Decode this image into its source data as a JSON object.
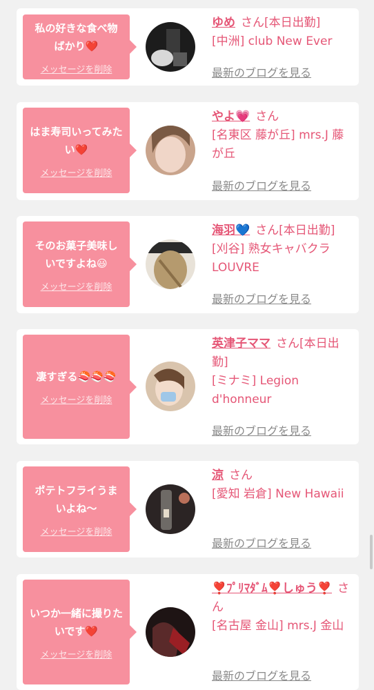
{
  "ui": {
    "delete_label": "メッセージを削除",
    "blog_label": "最新のブログを見る",
    "suffix": "さん"
  },
  "colors": {
    "bubble": "#f7909e",
    "accent": "#e55676",
    "link_gray": "#8a8a8a",
    "background": "#f1f1f1"
  },
  "messages": [
    {
      "text": "私の好きな食べ物ばかり❤️",
      "name": "ゆめ",
      "suffix": "さん[本日出勤]",
      "location": "[中洲] club New Ever"
    },
    {
      "text": "はま寿司いってみたい❤️",
      "name": "やよ💗",
      "suffix": "さん",
      "location": "[名東区 藤が丘] mrs.J 藤が丘"
    },
    {
      "text": "そのお菓子美味しいですよね😃",
      "name": "海羽💙",
      "suffix": "さん[本日出勤]",
      "location": "[刈谷] 熟女キャバクラ LOUVRE"
    },
    {
      "text": "凄すぎる🍣🍣🍣",
      "name": "英津子ママ",
      "suffix": "さん[本日出勤]",
      "location": "[ミナミ] Legion d'honneur"
    },
    {
      "text": "ポテトフライうまいよね〜",
      "name": "涼",
      "suffix": "さん",
      "location": "[愛知 岩倉] New Hawaii"
    },
    {
      "text": "いつか一緒に撮りたいです❤️",
      "name": "❣️ﾌﾟﾘﾏﾀﾞﾑ❣️しゅう❣️",
      "suffix": "さん",
      "location": "[名古屋 金山] mrs.J 金山"
    }
  ]
}
